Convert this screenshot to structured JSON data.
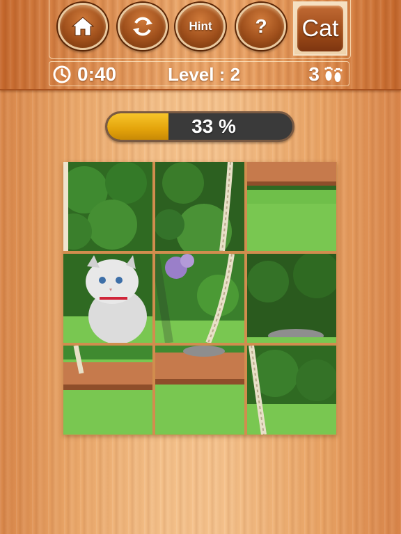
{
  "toolbar": {
    "home_icon": "home-icon",
    "restart_icon": "restart-icon",
    "hint_label": "Hint",
    "help_label": "?",
    "category_label": "Cat"
  },
  "status": {
    "time": "0:40",
    "level": "Level : 2",
    "moves": "3",
    "clock_icon": "clock-icon",
    "footprints_icon": "footprints-icon"
  },
  "progress": {
    "value": 0.33,
    "label": "33 %"
  },
  "puzzle": {
    "grid": "3x3",
    "tile_order": [
      0,
      1,
      2,
      3,
      4,
      5,
      6,
      7,
      8
    ]
  }
}
